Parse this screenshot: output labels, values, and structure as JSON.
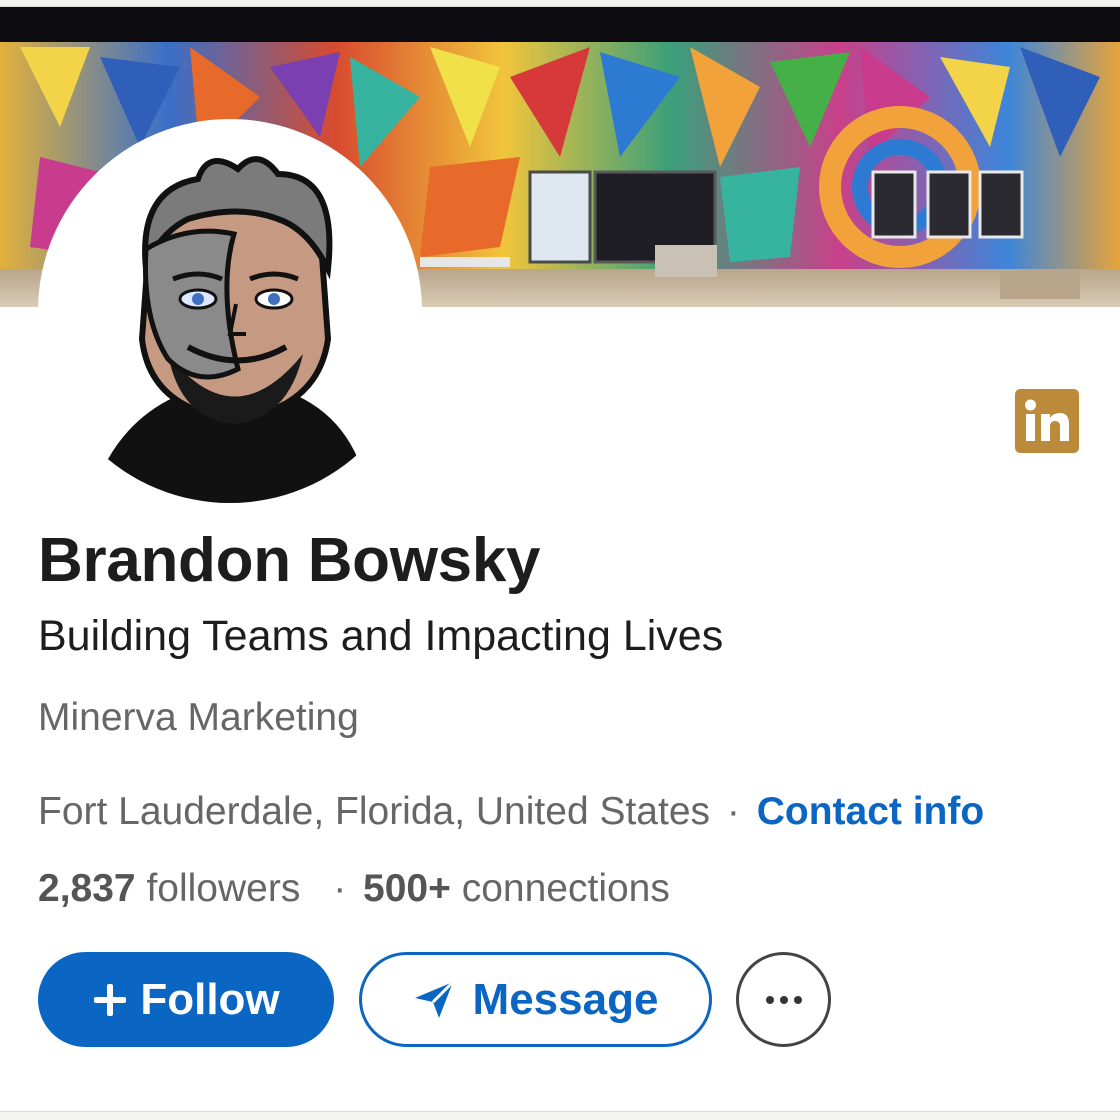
{
  "profile": {
    "name": "Brandon Bowsky",
    "headline": "Building Teams and Impacting Lives",
    "company": "Minerva Marketing",
    "location": "Fort Lauderdale, Florida, United States",
    "separator": "·",
    "contact_label": "Contact info"
  },
  "stats": {
    "followers_count": "2,837",
    "followers_label": "followers",
    "connections_count": "500+",
    "connections_label": "connections"
  },
  "actions": {
    "follow_label": "Follow",
    "follow_icon": "plus-icon",
    "message_label": "Message",
    "message_icon": "send-icon",
    "more_icon": "ellipsis-icon"
  },
  "brand": {
    "badge_text": "in",
    "badge_color": "#bb8a3a",
    "accent_color": "#0a66c2"
  }
}
